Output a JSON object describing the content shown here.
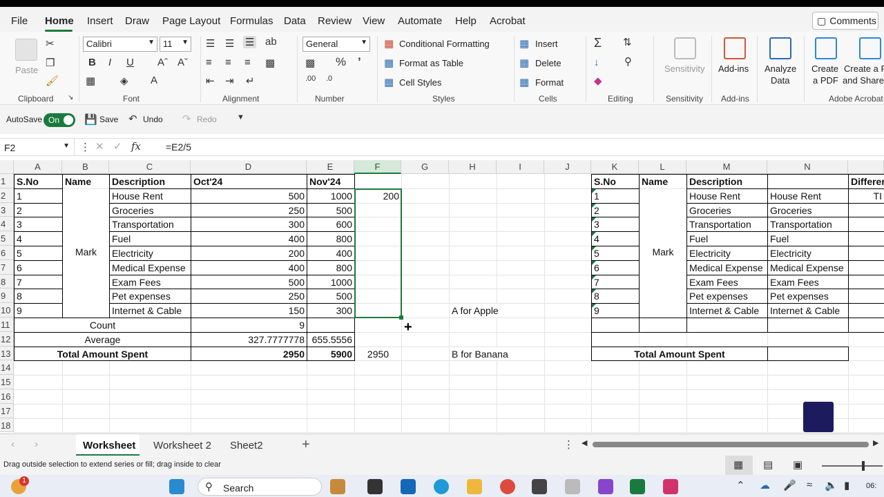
{
  "menu": {
    "tabs": [
      "File",
      "Home",
      "Insert",
      "Draw",
      "Page Layout",
      "Formulas",
      "Data",
      "Review",
      "View",
      "Automate",
      "Help",
      "Acrobat"
    ],
    "comments": "Comments"
  },
  "ribbon": {
    "clipboard": {
      "paste": "Paste",
      "label": "Clipboard"
    },
    "font": {
      "name": "Calibri",
      "size": "11",
      "label": "Font"
    },
    "alignment": {
      "label": "Alignment"
    },
    "number": {
      "format": "General",
      "label": "Number"
    },
    "styles": {
      "conditional": "Conditional Formatting",
      "format_table": "Format as Table",
      "cell_styles": "Cell Styles",
      "label": "Styles"
    },
    "cells": {
      "insert": "Insert",
      "delete": "Delete",
      "format": "Format",
      "label": "Cells"
    },
    "editing": {
      "label": "Editing"
    },
    "sensitivity": {
      "button": "Sensitivity",
      "label": "Sensitivity"
    },
    "addins": {
      "button": "Add-ins",
      "label": "Add-ins"
    },
    "analyze": {
      "line1": "Analyze",
      "line2": "Data"
    },
    "acrobat": {
      "create_line1": "Create",
      "create_line2": "a PDF",
      "share_line1": "Create a P",
      "share_line2": "and Share",
      "label": "Adobe Acrobat"
    }
  },
  "qat": {
    "autosave": "AutoSave",
    "toggle": "On",
    "save": "Save",
    "undo": "Undo",
    "redo": "Redo"
  },
  "formula_bar": {
    "name_box": "F2",
    "formula": "=E2/5"
  },
  "columns": [
    "A",
    "B",
    "C",
    "D",
    "E",
    "F",
    "G",
    "H",
    "I",
    "J",
    "K",
    "L",
    "M",
    "N"
  ],
  "rows": [
    "1",
    "2",
    "3",
    "4",
    "5",
    "6",
    "7",
    "8",
    "9",
    "10",
    "11",
    "12",
    "13",
    "14",
    "15",
    "16",
    "17",
    "18"
  ],
  "table1": {
    "headers": {
      "sno": "S.No",
      "name": "Name",
      "desc": "Description",
      "oct": "Oct'24",
      "nov": "Nov'24"
    },
    "name_value": "Mark",
    "rows": [
      {
        "sno": "1",
        "desc": "House Rent",
        "oct": "500",
        "nov": "1000"
      },
      {
        "sno": "2",
        "desc": "Groceries",
        "oct": "250",
        "nov": "500"
      },
      {
        "sno": "3",
        "desc": "Transportation",
        "oct": "300",
        "nov": "600"
      },
      {
        "sno": "4",
        "desc": "Fuel",
        "oct": "400",
        "nov": "800"
      },
      {
        "sno": "5",
        "desc": "Electricity",
        "oct": "200",
        "nov": "400"
      },
      {
        "sno": "6",
        "desc": "Medical Expense",
        "oct": "400",
        "nov": "800"
      },
      {
        "sno": "7",
        "desc": "Exam Fees",
        "oct": "500",
        "nov": "1000"
      },
      {
        "sno": "8",
        "desc": "Pet expenses",
        "oct": "250",
        "nov": "500"
      },
      {
        "sno": "9",
        "desc": "Internet & Cable",
        "oct": "150",
        "nov": "300"
      }
    ],
    "count_label": "Count",
    "count_value": "9",
    "average_label": "Average",
    "average_oct": "327.7777778",
    "average_nov": "655.5556",
    "total_label": "Total Amount Spent",
    "total_oct": "2950",
    "total_nov": "5900"
  },
  "f2_value": "200",
  "f13_value": "2950",
  "h10": "A for Apple",
  "h13": "B for Banana",
  "table2": {
    "headers": {
      "sno": "S.No",
      "name": "Name",
      "desc": "Description",
      "diff": "Differer"
    },
    "name_value": "Mark",
    "o2": "TI",
    "rows": [
      {
        "sno": "1",
        "m": "House Rent",
        "n": "House Rent"
      },
      {
        "sno": "2",
        "m": "Groceries",
        "n": "Groceries"
      },
      {
        "sno": "3",
        "m": "Transportation",
        "n": "Transportation"
      },
      {
        "sno": "4",
        "m": "Fuel",
        "n": "Fuel"
      },
      {
        "sno": "5",
        "m": "Electricity",
        "n": "Electricity"
      },
      {
        "sno": "6",
        "m": "Medical Expense",
        "n": "Medical Expense"
      },
      {
        "sno": "7",
        "m": "Exam Fees",
        "n": "Exam Fees"
      },
      {
        "sno": "8",
        "m": "Pet expenses",
        "n": "Pet expenses"
      },
      {
        "sno": "9",
        "m": "Internet & Cable",
        "n": "Internet & Cable"
      }
    ],
    "total_label": "Total Amount Spent"
  },
  "sheets": [
    "Worksheet",
    "Worksheet 2",
    "Sheet2"
  ],
  "status": "Drag outside selection to extend series or fill; drag inside to clear",
  "taskbar": {
    "search": "Search",
    "time": "06:"
  },
  "colors": {
    "accent": "#1a7a3e"
  }
}
